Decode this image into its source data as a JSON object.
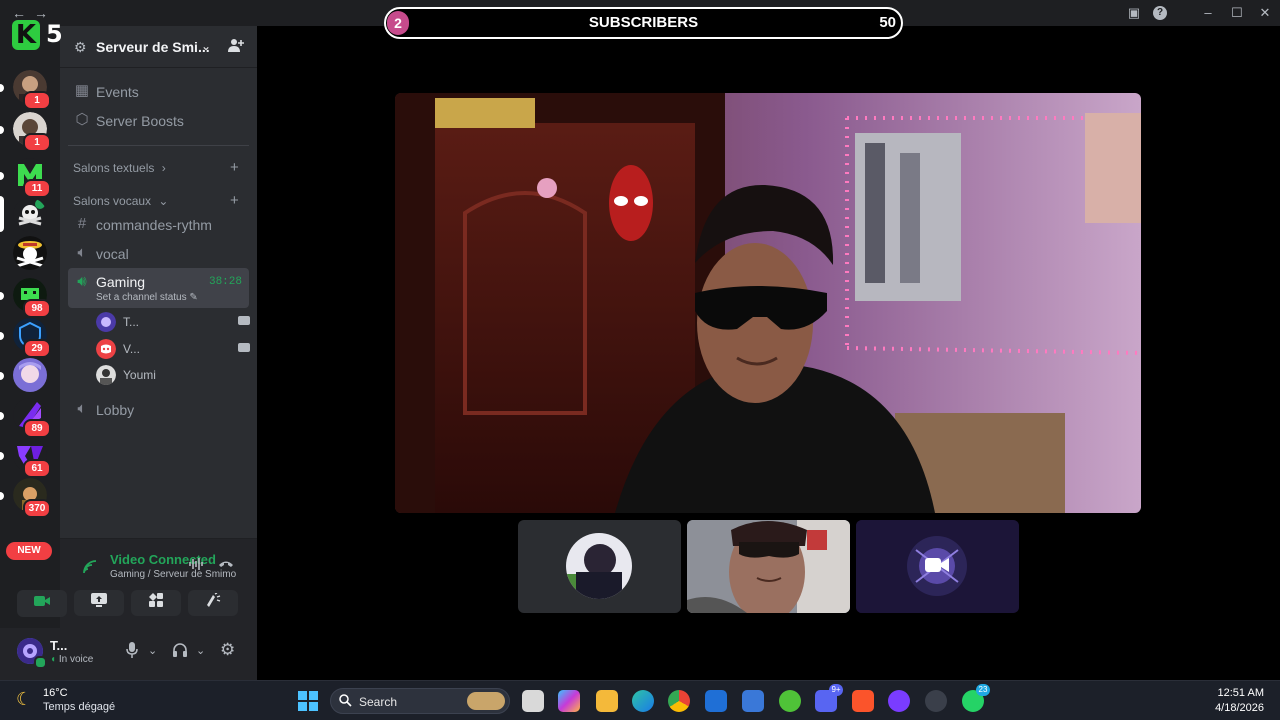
{
  "window": {
    "title": "Serveur de Smimo",
    "back": "←",
    "forward": "→"
  },
  "overlay": {
    "logo_letter": "K",
    "logo_number": "5",
    "sub_count": "2",
    "sub_label": "SUBSCRIBERS",
    "sub_goal": "50"
  },
  "rail": {
    "badges": [
      "1",
      "1",
      "11",
      "98",
      "29",
      "89",
      "61",
      "370"
    ],
    "new_label": "NEW"
  },
  "server": {
    "name": "Serveur de Smi...",
    "chevron": "⌄"
  },
  "channels": {
    "events": "Events",
    "boosts": "Server Boosts",
    "text_category": "Salons textuels",
    "voice_category": "Salons vocaux",
    "commandes": "commandes-rythm",
    "vocal": "vocal",
    "gaming": "Gaming",
    "gaming_timer": "38:28",
    "gaming_status": "Set a channel status",
    "lobby": "Lobby",
    "members": [
      {
        "name": "T..."
      },
      {
        "name": "V..."
      },
      {
        "name": "Youmi"
      }
    ]
  },
  "voice": {
    "status": "Video Connected",
    "location": "Gaming / Serveur de Smimo"
  },
  "user": {
    "name": "T...",
    "status": "In voice"
  },
  "taskbar": {
    "temperature": "16°C",
    "condition": "Temps dégagé",
    "search_placeholder": "Search",
    "discord_badge": "9+",
    "whatsapp_badge": "23",
    "time": "12:51 AM",
    "date": "4/18/2026"
  },
  "colors": {
    "accent_green": "#23a55a",
    "badge_red": "#f23f43",
    "blurple": "#5865f2"
  }
}
